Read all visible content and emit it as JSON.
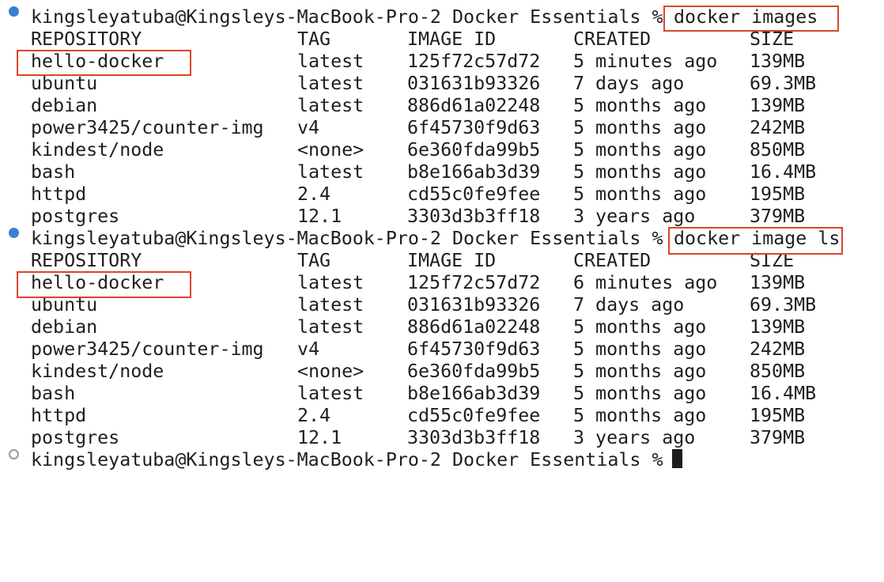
{
  "terminal": {
    "prompt": "kingsleyatuba@Kingsleys-MacBook-Pro-2 Docker Essentials %",
    "colors": {
      "text": "#1e1e1e",
      "marker_done": "#3a7fd5",
      "marker_pending": "#9a9a9a",
      "highlight_box": "#d9452c"
    },
    "commands": [
      {
        "command": "docker images",
        "header": {
          "repository": "REPOSITORY",
          "tag": "TAG",
          "image_id": "IMAGE ID",
          "created": "CREATED",
          "size": "SIZE"
        },
        "rows": [
          {
            "repository": "hello-docker",
            "tag": "latest",
            "image_id": "125f72c57d72",
            "created": "5 minutes ago",
            "size": "139MB"
          },
          {
            "repository": "ubuntu",
            "tag": "latest",
            "image_id": "031631b93326",
            "created": "7 days ago",
            "size": "69.3MB"
          },
          {
            "repository": "debian",
            "tag": "latest",
            "image_id": "886d61a02248",
            "created": "5 months ago",
            "size": "139MB"
          },
          {
            "repository": "power3425/counter-img",
            "tag": "v4",
            "image_id": "6f45730f9d63",
            "created": "5 months ago",
            "size": "242MB"
          },
          {
            "repository": "kindest/node",
            "tag": "<none>",
            "image_id": "6e360fda99b5",
            "created": "5 months ago",
            "size": "850MB"
          },
          {
            "repository": "bash",
            "tag": "latest",
            "image_id": "b8e166ab3d39",
            "created": "5 months ago",
            "size": "16.4MB"
          },
          {
            "repository": "httpd",
            "tag": "2.4",
            "image_id": "cd55c0fe9fee",
            "created": "5 months ago",
            "size": "195MB"
          },
          {
            "repository": "postgres",
            "tag": "12.1",
            "image_id": "3303d3b3ff18",
            "created": "3 years ago",
            "size": "379MB"
          }
        ]
      },
      {
        "command": "docker image ls",
        "header": {
          "repository": "REPOSITORY",
          "tag": "TAG",
          "image_id": "IMAGE ID",
          "created": "CREATED",
          "size": "SIZE"
        },
        "rows": [
          {
            "repository": "hello-docker",
            "tag": "latest",
            "image_id": "125f72c57d72",
            "created": "6 minutes ago",
            "size": "139MB"
          },
          {
            "repository": "ubuntu",
            "tag": "latest",
            "image_id": "031631b93326",
            "created": "7 days ago",
            "size": "69.3MB"
          },
          {
            "repository": "debian",
            "tag": "latest",
            "image_id": "886d61a02248",
            "created": "5 months ago",
            "size": "139MB"
          },
          {
            "repository": "power3425/counter-img",
            "tag": "v4",
            "image_id": "6f45730f9d63",
            "created": "5 months ago",
            "size": "242MB"
          },
          {
            "repository": "kindest/node",
            "tag": "<none>",
            "image_id": "6e360fda99b5",
            "created": "5 months ago",
            "size": "850MB"
          },
          {
            "repository": "bash",
            "tag": "latest",
            "image_id": "b8e166ab3d39",
            "created": "5 months ago",
            "size": "16.4MB"
          },
          {
            "repository": "httpd",
            "tag": "2.4",
            "image_id": "cd55c0fe9fee",
            "created": "5 months ago",
            "size": "195MB"
          },
          {
            "repository": "postgres",
            "tag": "12.1",
            "image_id": "3303d3b3ff18",
            "created": "3 years ago",
            "size": "379MB"
          }
        ]
      }
    ]
  }
}
